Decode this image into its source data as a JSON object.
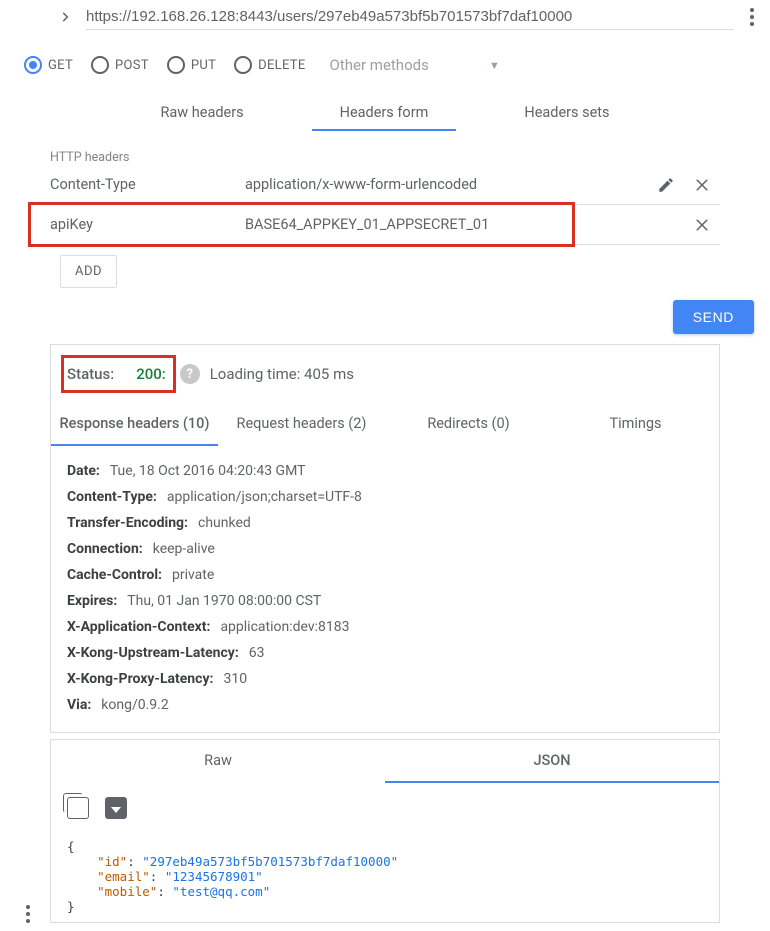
{
  "url": "https://192.168.26.128:8443/users/297eb49a573bf5b701573bf7daf10000",
  "methods": {
    "items": [
      {
        "label": "GET",
        "selected": true
      },
      {
        "label": "POST",
        "selected": false
      },
      {
        "label": "PUT",
        "selected": false
      },
      {
        "label": "DELETE",
        "selected": false
      }
    ],
    "other_label": "Other methods"
  },
  "tabs": {
    "raw_headers": "Raw headers",
    "headers_form": "Headers form",
    "headers_sets": "Headers sets",
    "active": "headers_form"
  },
  "headers_section": {
    "title": "HTTP headers",
    "rows": [
      {
        "name": "Content-Type",
        "value": "application/x-www-form-urlencoded",
        "editable": true
      },
      {
        "name": "apiKey",
        "value": "BASE64_APPKEY_01_APPSECRET_01",
        "highlighted": true
      }
    ],
    "add_label": "ADD"
  },
  "send_label": "SEND",
  "response": {
    "status_label": "Status:",
    "status_code": "200:",
    "loading_label": "Loading time: 405 ms",
    "tabs": {
      "response_headers": "Response headers (10)",
      "request_headers": "Request headers (2)",
      "redirects": "Redirects (0)",
      "timings": "Timings"
    },
    "headers": [
      {
        "k": "Date:",
        "v": "Tue, 18 Oct 2016 04:20:43 GMT"
      },
      {
        "k": "Content-Type:",
        "v": "application/json;charset=UTF-8"
      },
      {
        "k": "Transfer-Encoding:",
        "v": "chunked"
      },
      {
        "k": "Connection:",
        "v": "keep-alive"
      },
      {
        "k": "Cache-Control:",
        "v": "private"
      },
      {
        "k": "Expires:",
        "v": "Thu, 01 Jan 1970 08:00:00 CST"
      },
      {
        "k": "X-Application-Context:",
        "v": "application:dev:8183"
      },
      {
        "k": "X-Kong-Upstream-Latency:",
        "v": "63"
      },
      {
        "k": "X-Kong-Proxy-Latency:",
        "v": "310"
      },
      {
        "k": "Via:",
        "v": "kong/0.9.2"
      }
    ]
  },
  "body": {
    "tabs": {
      "raw": "Raw",
      "json": "JSON"
    },
    "json": {
      "id": "297eb49a573bf5b701573bf7daf10000",
      "email": "12345678901",
      "mobile": "test@qq.com"
    }
  }
}
